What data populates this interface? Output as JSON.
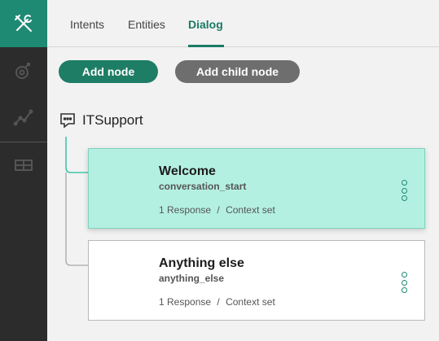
{
  "rail": {
    "items": [
      {
        "name": "tools-icon",
        "active": true
      },
      {
        "name": "intent-analytics-icon",
        "active": false
      },
      {
        "name": "line-chart-icon",
        "active": false
      },
      {
        "name": "table-grid-icon",
        "active": false
      }
    ]
  },
  "tabs": [
    {
      "label": "Intents"
    },
    {
      "label": "Entities"
    },
    {
      "label": "Dialog"
    }
  ],
  "toolbar": {
    "add_node_label": "Add node",
    "add_child_node_label": "Add child node"
  },
  "workspace": {
    "title": "ITSupport"
  },
  "nodes": [
    {
      "title": "Welcome",
      "condition": "conversation_start",
      "responses": "1 Response",
      "separator": "/",
      "context": "Context set",
      "selected": true
    },
    {
      "title": "Anything else",
      "condition": "anything_else",
      "responses": "1 Response",
      "separator": "/",
      "context": "Context set",
      "selected": false
    }
  ],
  "colors": {
    "accent": "#1e7d65",
    "selected_node_bg": "#b4f0e1",
    "rail_bg": "#2c2c2c"
  }
}
